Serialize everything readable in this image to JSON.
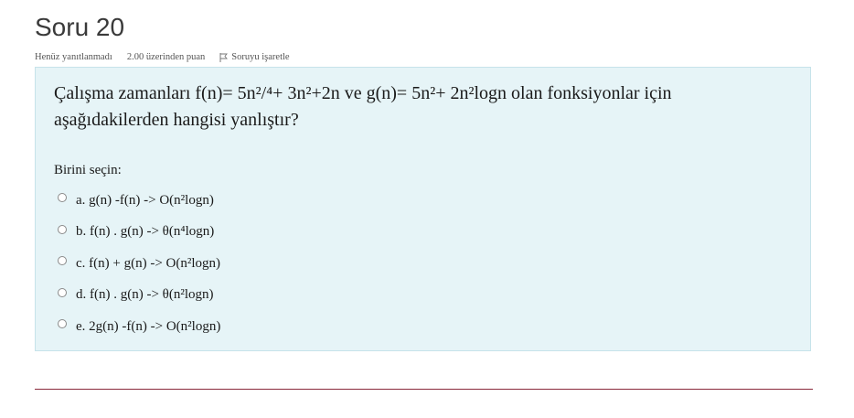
{
  "question_header": {
    "title": "Soru 20",
    "status": "Henüz yanıtlanmadı",
    "points": "2.00 üzerinden puan",
    "flag_label": "Soruyu işaretle"
  },
  "question": {
    "line1": "Çalışma zamanları f(n)= 5n²/⁴+ 3n²+2n ve g(n)= 5n²+ 2n²logn olan fonksiyonlar için",
    "line2": "aşağıdakilerden hangisi yanlıştır?",
    "prompt": "Birini seçin:",
    "options": [
      "a. g(n) -f(n)  -> O(n²logn)",
      "b. f(n) . g(n) -> θ(n⁴logn)",
      "c. f(n) + g(n) -> O(n²logn)",
      "d. f(n) . g(n) -> θ(n²logn)",
      "e. 2g(n) -f(n) -> O(n²logn)"
    ]
  },
  "colors": {
    "panel_bg": "#e6f4f7",
    "panel_border": "#c6e3ea",
    "divider": "#8a2a3c"
  }
}
